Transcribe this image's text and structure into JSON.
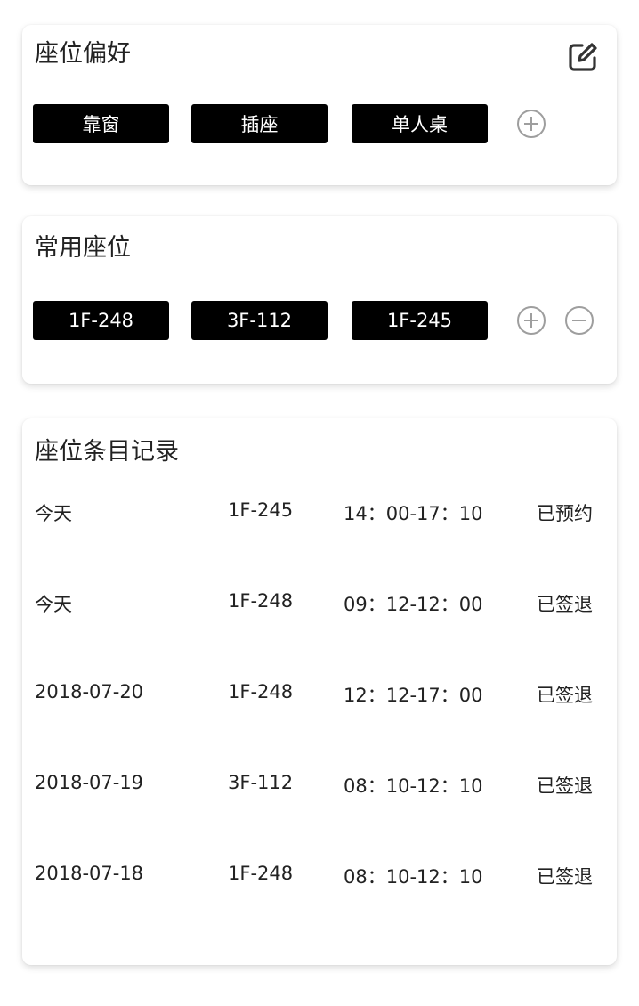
{
  "preferences": {
    "title": "座位偏好",
    "tags": [
      "靠窗",
      "插座",
      "单人桌"
    ],
    "edit_icon": "edit-icon",
    "add_icon": "plus-circle-icon"
  },
  "favorites": {
    "title": "常用座位",
    "seats": [
      "1F-248",
      "3F-112",
      "1F-245"
    ],
    "add_icon": "plus-circle-icon",
    "remove_icon": "minus-circle-icon"
  },
  "records": {
    "title": "座位条目记录",
    "rows": [
      {
        "date": "今天",
        "seat": "1F-245",
        "time": "14：00-17：10",
        "status": "已预约"
      },
      {
        "date": "今天",
        "seat": "1F-248",
        "time": "09：12-12：00",
        "status": "已签退"
      },
      {
        "date": "2018-07-20",
        "seat": "1F-248",
        "time": "12：12-17：00",
        "status": "已签退"
      },
      {
        "date": "2018-07-19",
        "seat": "3F-112",
        "time": "08：10-12：10",
        "status": "已签退"
      },
      {
        "date": "2018-07-18",
        "seat": "1F-248",
        "time": "08：10-12：10",
        "status": "已签退"
      }
    ]
  },
  "colors": {
    "tag_bg": "#000000",
    "tag_text": "#ffffff",
    "icon_gray": "#9e9e9e",
    "edit_icon": "#333333"
  }
}
